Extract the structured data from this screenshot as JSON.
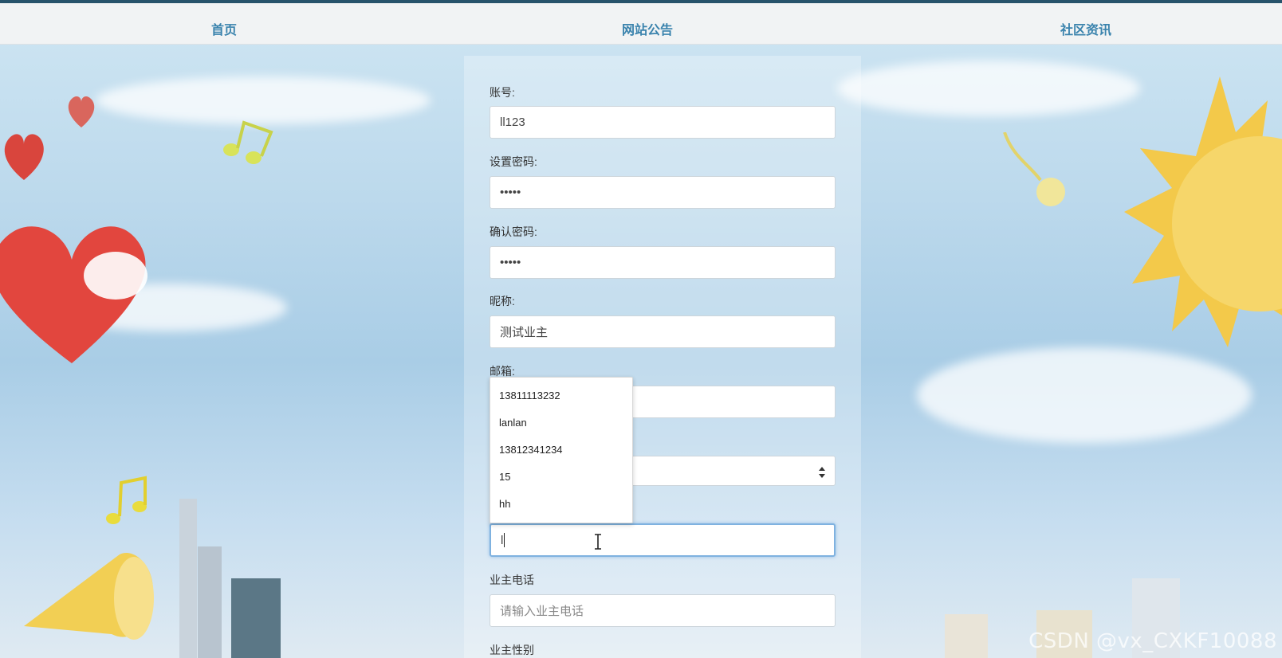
{
  "nav": {
    "home": "首页",
    "announcement": "网站公告",
    "news": "社区资讯"
  },
  "form": {
    "account_label": "账号:",
    "account_value": "ll123",
    "password_label": "设置密码:",
    "password_value": "•••••",
    "confirm_label": "确认密码:",
    "confirm_value": "•••••",
    "nickname_label": "昵称:",
    "nickname_value": "测试业主",
    "email_label": "邮箱:",
    "owner_name_value": "l",
    "owner_phone_label": "业主电话",
    "owner_phone_placeholder": "请输入业主电话",
    "owner_gender_label": "业主性别"
  },
  "autocomplete": {
    "items": [
      "13811113232",
      "lanlan",
      "13812341234",
      "15",
      "hh"
    ]
  },
  "watermark": "CSDN @vx_CXKF10088",
  "colors": {
    "nav_text": "#3a83ad",
    "nav_border": "#27536b",
    "focus_border": "#7fb2e0"
  }
}
